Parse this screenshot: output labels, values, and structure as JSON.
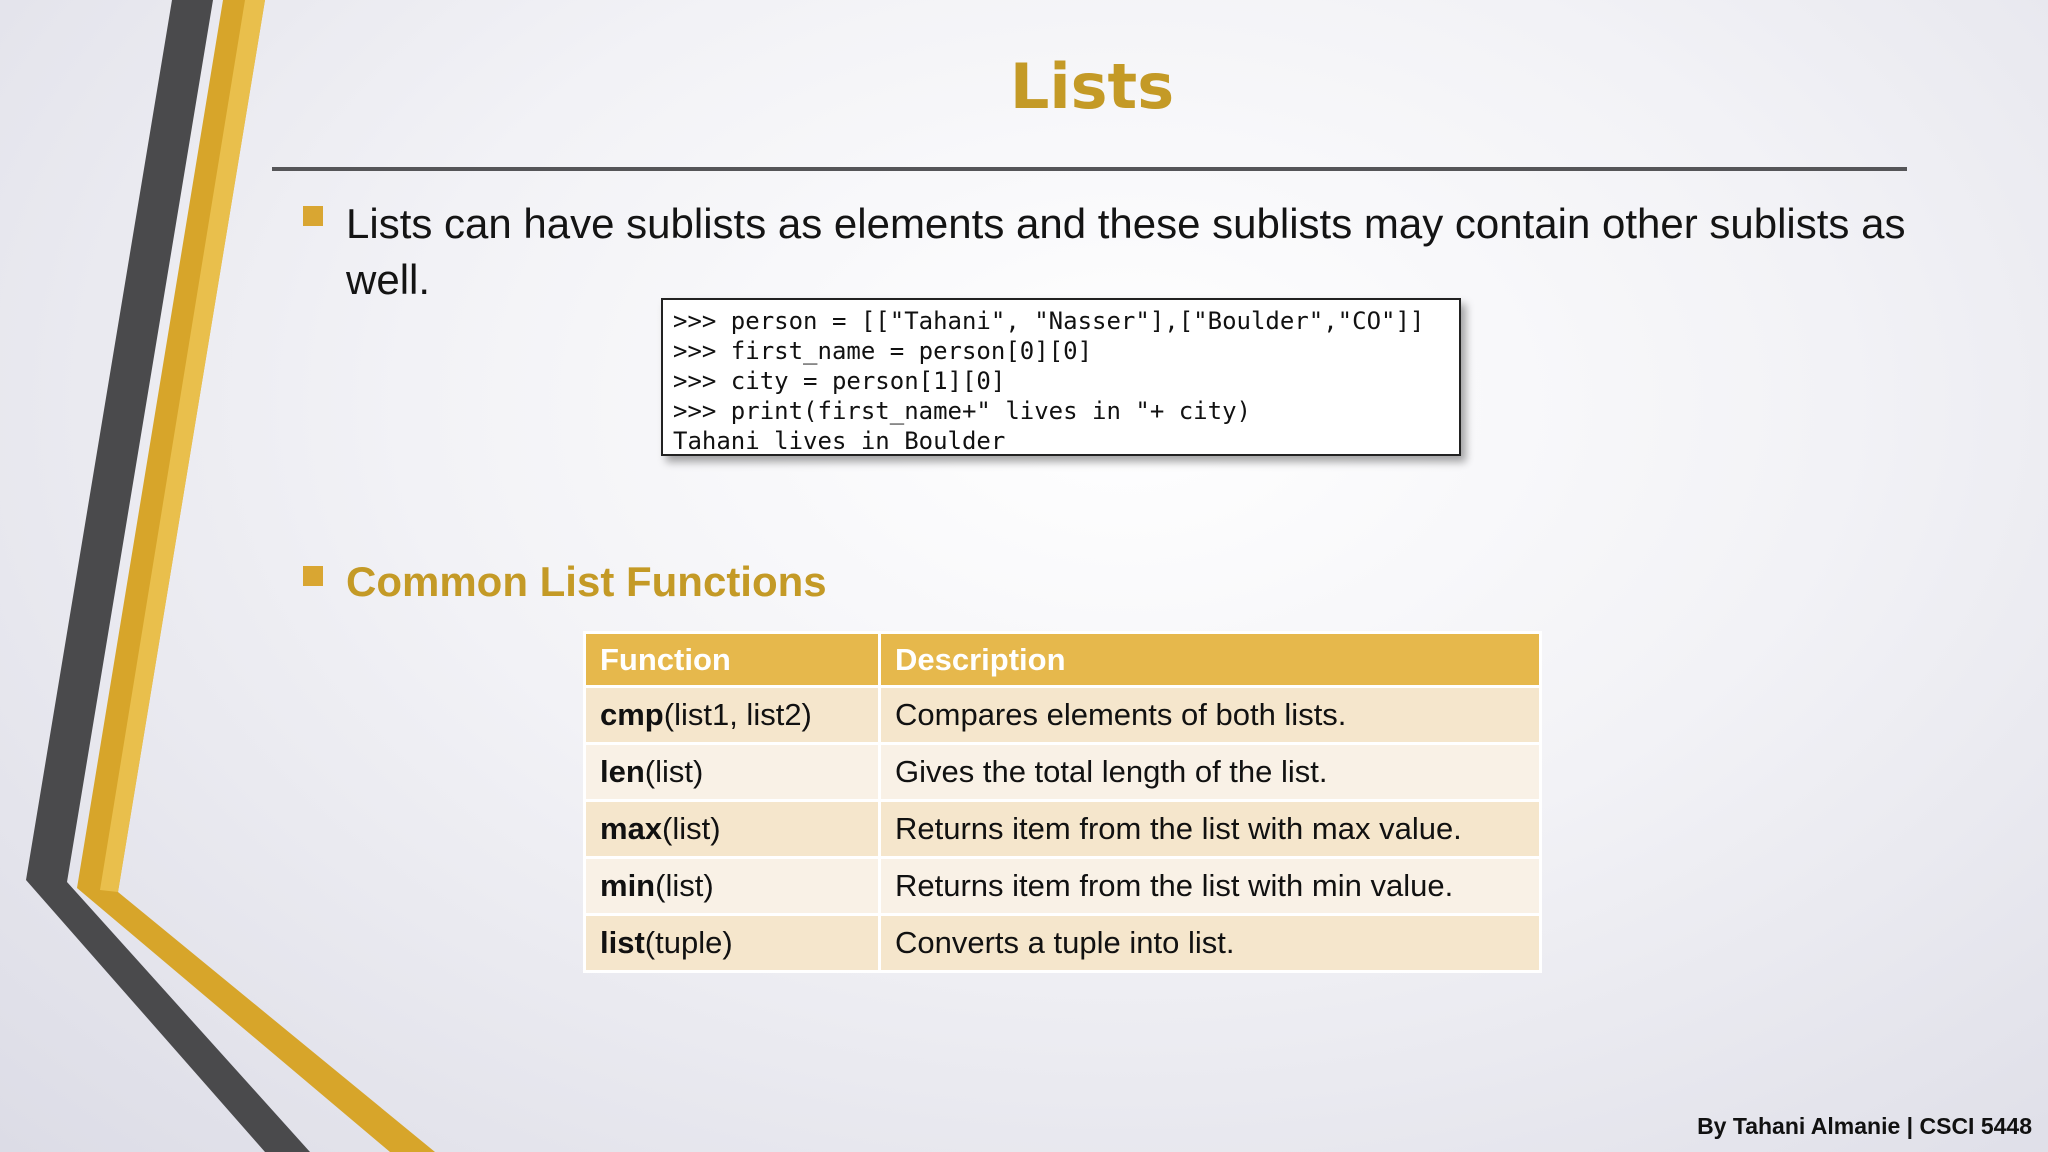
{
  "slide": {
    "title": "Lists",
    "intro_text": "Lists can have sublists as elements and these sublists may contain other sublists as well.",
    "code_lines": [
      ">>> person = [[\"Tahani\", \"Nasser\"],[\"Boulder\",\"CO\"]]",
      ">>> first_name = person[0][0]",
      ">>> city = person[1][0]",
      ">>> print(first_name+\" lives in \"+ city)",
      "Tahani lives in Boulder"
    ],
    "section_heading": "Common List Functions",
    "table": {
      "headers": [
        "Function",
        "Description"
      ],
      "rows": [
        {
          "name": "cmp",
          "args": "(list1, list2)",
          "description": "Compares elements of both lists."
        },
        {
          "name": "len",
          "args": "(list)",
          "description": "Gives the total length of the list."
        },
        {
          "name": "max",
          "args": "(list)",
          "description": "Returns item from the list with max value."
        },
        {
          "name": "min",
          "args": "(list)",
          "description": "Returns item from the list with min value."
        },
        {
          "name": "list",
          "args": "(tuple)",
          "description": "Converts a tuple into list."
        }
      ]
    },
    "footer": "By Tahani Almanie | CSCI 5448"
  },
  "colors": {
    "accent_gold": "#c49a26",
    "header_gold": "#e6b84c",
    "row_odd": "#f5e6cc",
    "row_even": "#f9f1e6",
    "stripe_dark": "#4a4a4c"
  }
}
